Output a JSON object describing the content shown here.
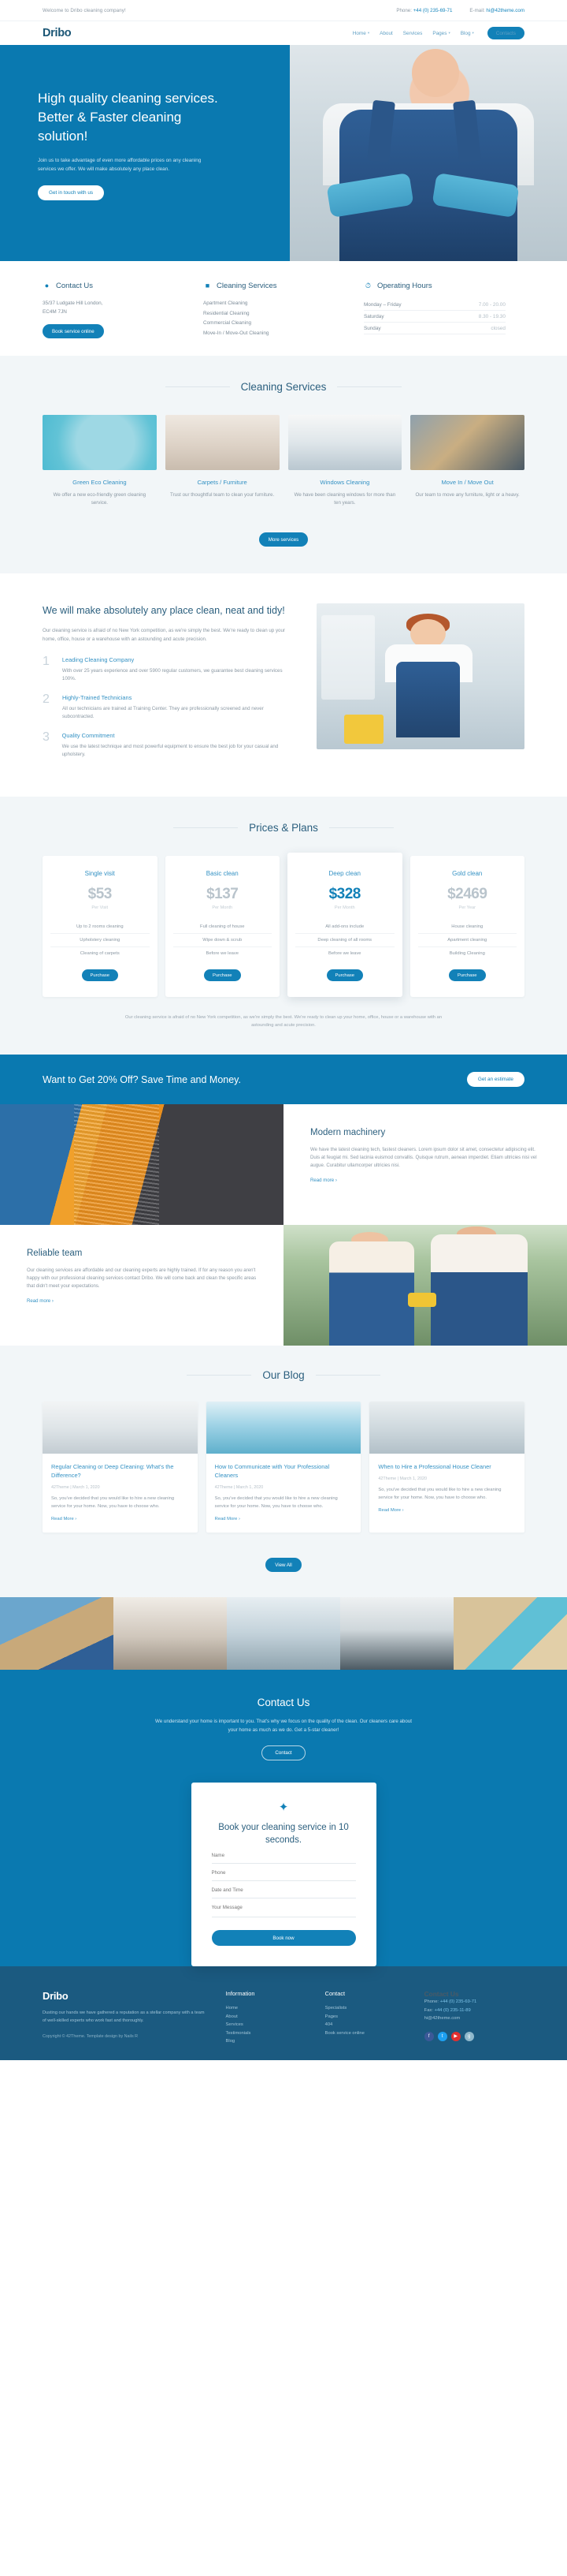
{
  "topbar": {
    "welcome": "Welcome to Dribo cleaning company!",
    "phone_label": "Phone:",
    "phone_value": "+44 (0) 235-69-71",
    "email_label": "E-mail:",
    "email_value": "hi@42theme.com"
  },
  "nav": {
    "logo": "Dribo",
    "items": [
      {
        "label": "Home",
        "caret": "▾"
      },
      {
        "label": "About",
        "caret": ""
      },
      {
        "label": "Services",
        "caret": ""
      },
      {
        "label": "Pages",
        "caret": "▾"
      },
      {
        "label": "Blog",
        "caret": "▾"
      }
    ],
    "cta": "Contacts"
  },
  "hero": {
    "title": "High quality cleaning services. Better & Faster cleaning solution!",
    "text": "Join us to take advantage of even more affordable prices on any cleaning services we offer. We will make absolutely any place clean.",
    "button": "Get in touch with us"
  },
  "infobar": {
    "contact": {
      "icon": "location-pin-icon",
      "title": "Contact Us",
      "address": "35/37 Ludgate Hill London, EC4M 7JN",
      "button": "Book service online"
    },
    "services": {
      "icon": "cleaning-icon",
      "title": "Cleaning Services",
      "items": [
        "Apartment Cleaning",
        "Residential Cleaning",
        "Commercial Cleaning",
        "Move-In / Move-Out Cleaning"
      ]
    },
    "hours": {
      "icon": "clock-icon",
      "title": "Operating Hours",
      "rows": [
        {
          "day": "Monday – Friday",
          "time": "7.00 - 20.00"
        },
        {
          "day": "Saturday",
          "time": "8.30 - 19.30"
        },
        {
          "day": "Sunday",
          "time": "closed"
        }
      ]
    }
  },
  "services_section": {
    "title": "Cleaning Services",
    "cards": [
      {
        "title": "Green Eco Cleaning",
        "text": "We offer a new eco-friendly green cleaning service."
      },
      {
        "title": "Carpets / Furniture",
        "text": "Trust our thoughtful team to clean your furniture."
      },
      {
        "title": "Windows Cleaning",
        "text": "We have been cleaning windows for more than ten years."
      },
      {
        "title": "Move In / Move Out",
        "text": "Our team to move any furniture, light or a heavy."
      }
    ],
    "button": "More services"
  },
  "about": {
    "title": "We will make absolutely any place clean, neat and tidy!",
    "lead": "Our cleaning service is afraid of no New York competition, as we're simply the best. We're ready to clean up your home, office, house or a warehouse with an astounding and acute precision.",
    "steps": [
      {
        "num": "1",
        "title": "Leading Cleaning Company",
        "text": "With over 25 years experience and over 5900 regular customers, we guarantee best cleaning services 100%."
      },
      {
        "num": "2",
        "title": "Highly-Trained Technicians",
        "text": "All our technicians are trained at Training Center. They are professionally screened and never subcontracted."
      },
      {
        "num": "3",
        "title": "Quality Commitment",
        "text": "We use the latest technique and most powerful equipment to ensure the best job for your casual and upholstery."
      }
    ]
  },
  "pricing": {
    "title": "Prices & Plans",
    "plans": [
      {
        "name": "Single visit",
        "price": "$53",
        "period": "Per Visit",
        "features": [
          "Up to 2 rooms cleaning",
          "Upholstery cleaning",
          "Cleaning of carpets"
        ],
        "button": "Purchase",
        "featured": false
      },
      {
        "name": "Basic clean",
        "price": "$137",
        "period": "Per Month",
        "features": [
          "Full cleaning of house",
          "Wipe down & scrub",
          "Before we leave"
        ],
        "button": "Purchase",
        "featured": false
      },
      {
        "name": "Deep clean",
        "price": "$328",
        "period": "Per Month",
        "features": [
          "All add-ons include",
          "Deep cleaning of all rooms",
          "Before we leave"
        ],
        "button": "Purchase",
        "featured": true
      },
      {
        "name": "Gold clean",
        "price": "$2469",
        "period": "Per Year",
        "features": [
          "House cleaning",
          "Apartment cleaning",
          "Building Cleaning"
        ],
        "button": "Purchase",
        "featured": false
      }
    ],
    "footnote": "Our cleaning service is afraid of no New York competition, as we're simply the best. We're ready to clean up your home, office, house or a warehouse with an astounding and acute precision."
  },
  "cta": {
    "title": "Want to Get 20% Off? Save Time and Money.",
    "button": "Get an estimate"
  },
  "machinery": {
    "title": "Modern machinery",
    "text": "We have the latest cleaning tech, fastest cleaners. Lorem ipsum dolor sit amet, consectetur adipiscing elit. Duis at feugiat mi. Sed lacinia euismod convallis. Quisque rutrum, aenean imperdiet. Etiam ultricies nisi vel augue. Curabitur ullamcorper ultricies nisi.",
    "link": "Read more ›"
  },
  "team": {
    "title": "Reliable team",
    "text": "Our cleaning services are affordable and our cleaning experts are highly trained. If for any reason you aren't happy with our professional cleaning services contact Dribo. We will come back and clean the specific areas that didn't meet your expectations.",
    "link": "Read more ›"
  },
  "blog": {
    "title": "Our Blog",
    "posts": [
      {
        "title": "Regular Cleaning or Deep Cleaning: What's the Difference?",
        "meta": "42Theme | March 1, 2020",
        "text": "So, you've decided that you would like to hire a new cleaning service for your home. Now, you have to choose who.",
        "link": "Read More ›"
      },
      {
        "title": "How to Communicate with Your Professional Cleaners",
        "meta": "42Theme | March 1, 2020",
        "text": "So, you've decided that you would like to hire a new cleaning service for your home. Now, you have to choose who.",
        "link": "Read More ›"
      },
      {
        "title": "When to Hire a Professional House Cleaner",
        "meta": "42Theme | March 1, 2020",
        "text": "So, you've decided that you would like to hire a new cleaning service for your home. Now, you have to choose who.",
        "link": "Read More ›"
      }
    ],
    "button": "View All"
  },
  "contact": {
    "title": "Contact Us",
    "text": "We understand your home is important to you. That's why we focus on the quality of the clean. Our cleaners care about your home as much as we do. Get a 5-star cleaner!",
    "button": "Contact",
    "form": {
      "icon": "broom-icon",
      "heading": "Book your cleaning service in 10 seconds.",
      "fields": [
        {
          "name": "name-field",
          "placeholder": "Name",
          "type": "text"
        },
        {
          "name": "phone-field",
          "placeholder": "Phone",
          "type": "text"
        },
        {
          "name": "date-time-field",
          "placeholder": "Date and Time",
          "type": "text"
        },
        {
          "name": "message-field",
          "placeholder": "Your Message",
          "type": "textarea"
        }
      ],
      "submit": "Book now"
    }
  },
  "footer": {
    "logo": "Dribo",
    "about": "Dusting our hands we have gathered a reputation as a stellar company with a team of well-skilled experts who work fast and thoroughly.",
    "copyright": "Copyright © 42Theme. Template design by Nails R",
    "information": {
      "title": "Information",
      "items": [
        "Home",
        "About",
        "Services",
        "Testimonials",
        "Blog"
      ]
    },
    "contact_links": {
      "title": "Contact",
      "items": [
        "Specialists",
        "Pages",
        "404",
        "Book service online"
      ]
    },
    "contacts": {
      "title": "Contact Us",
      "phone_label": "Phone:",
      "phone": "+44 (0) 235-69-71",
      "fax_label": "Fax:",
      "fax": "+44 (0) 235-11-89",
      "email": "hi@42theme.com",
      "socials": [
        "facebook-icon",
        "twitter-icon",
        "youtube-icon",
        "googleplus-icon"
      ]
    }
  },
  "colors": {
    "brand_blue": "#0a79b0",
    "accent_blue": "#1281b8",
    "dark_blue": "#2b5f7e",
    "footer_blue": "#1b5a80",
    "light_bg": "#f2f6f8"
  }
}
